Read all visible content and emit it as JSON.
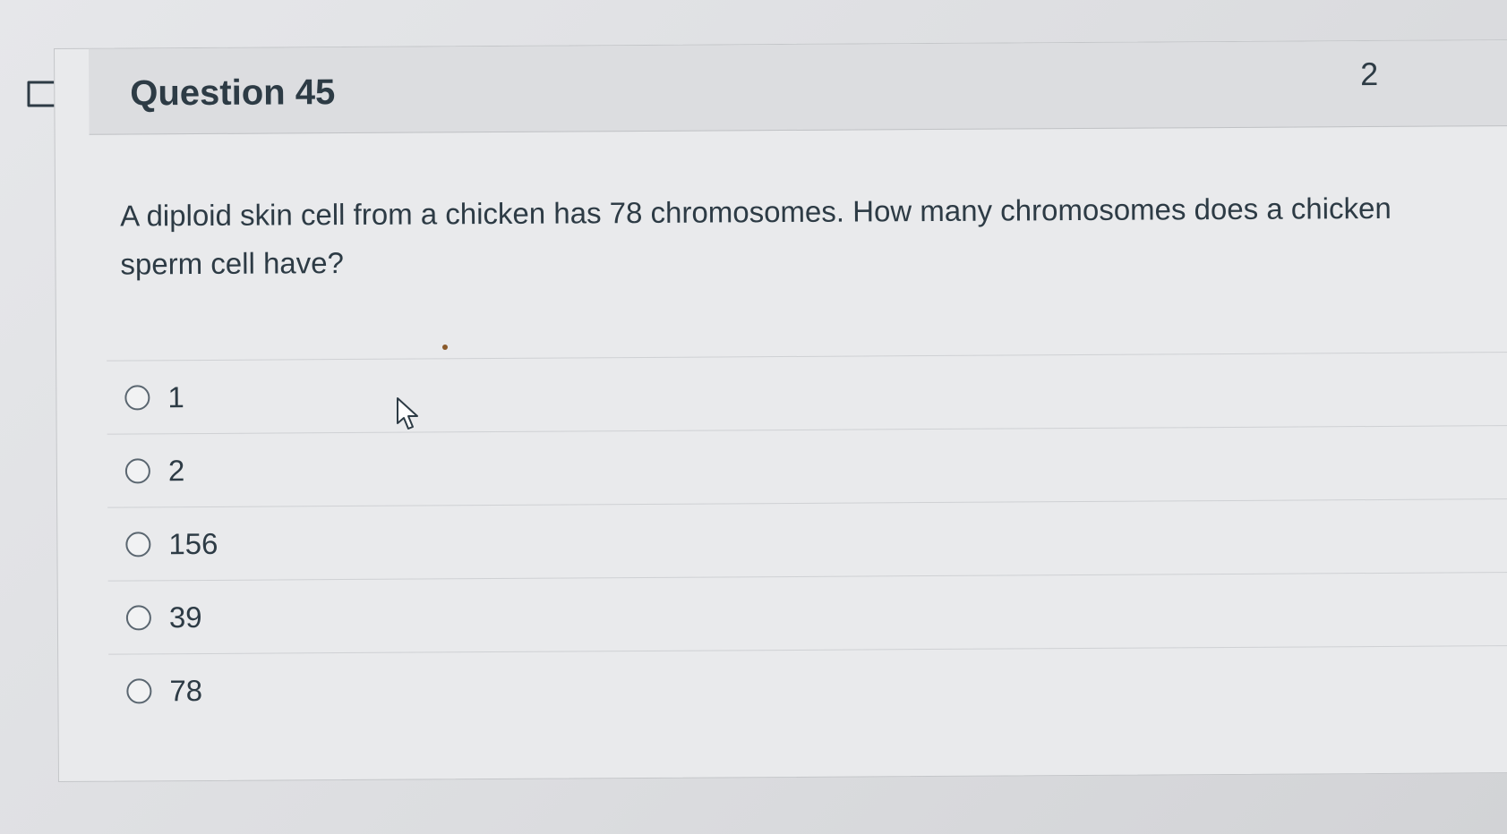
{
  "question": {
    "title": "Question 45",
    "points": "2",
    "text": "A diploid skin cell from a chicken has 78 chromosomes. How many chromosomes does a chicken sperm cell have?"
  },
  "answers": [
    {
      "label": "1"
    },
    {
      "label": "2"
    },
    {
      "label": "156"
    },
    {
      "label": "39"
    },
    {
      "label": "78"
    }
  ],
  "icons": {
    "flag": "flag-icon",
    "radio": "radio-icon",
    "cursor": "mouse-pointer-icon"
  }
}
